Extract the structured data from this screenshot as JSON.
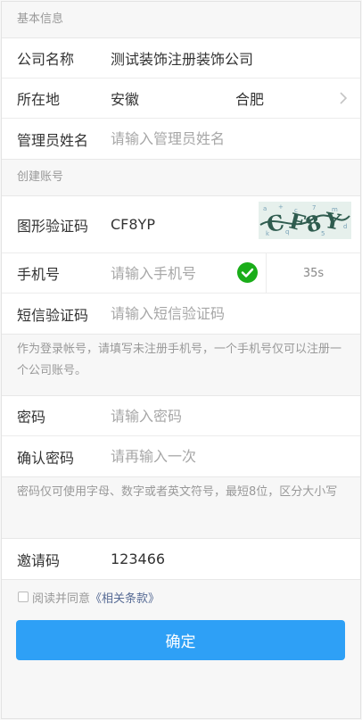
{
  "sections": {
    "basic_info": "基本信息",
    "create_account": "创建账号"
  },
  "company": {
    "label": "公司名称",
    "value": "测试装饰注册装饰公司"
  },
  "location": {
    "label": "所在地",
    "province": "安徽",
    "city": "合肥"
  },
  "admin_name": {
    "label": "管理员姓名",
    "placeholder": "请输入管理员姓名"
  },
  "captcha": {
    "label": "图形验证码",
    "value": "CF8YP",
    "image_text": "CF8YP"
  },
  "phone": {
    "label": "手机号",
    "placeholder": "请输入手机号",
    "countdown": "35s"
  },
  "sms_code": {
    "label": "短信验证码",
    "placeholder": "请输入短信验证码"
  },
  "phone_tip": "作为登录帐号，请填写未注册手机号，一个手机号仅可以注册一个公司账号。",
  "password": {
    "label": "密码",
    "placeholder": "请输入密码"
  },
  "confirm_password": {
    "label": "确认密码",
    "placeholder": "请再输入一次"
  },
  "password_tip": "密码仅可使用字母、数字或者英文符号，最短8位，区分大小写",
  "invite": {
    "label": "邀请码",
    "value": "123466"
  },
  "agreement": {
    "prefix": "阅读并同意",
    "link": "《相关条款》"
  },
  "submit_label": "确定",
  "colors": {
    "primary": "#2ea0f6",
    "success": "#1aad19",
    "link": "#576b95"
  }
}
